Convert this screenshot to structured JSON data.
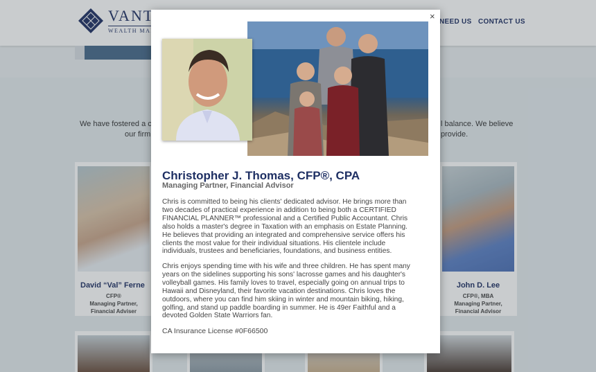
{
  "header": {
    "logo_name": "VANT",
    "logo_sub": "WEALTH MANAG",
    "nav": [
      "NEED US",
      "CONTACT US"
    ]
  },
  "intro": {
    "left_line1": "We have fostered a cu",
    "left_line2": "our firm",
    "right_line1": "l balance. We believe",
    "right_line2": "provide."
  },
  "cards": [
    {
      "name": "David “Val” Ferne",
      "title_lines": [
        "CFP®",
        "Managing Partner,",
        "Financial Adviser"
      ]
    },
    {
      "name": "John D. Lee",
      "title_lines": [
        "CFP®, MBA",
        "Managing Partner,",
        "Financial Advisor"
      ]
    }
  ],
  "modal": {
    "close_label": "×",
    "name": "Christopher J. Thomas, CFP®, CPA",
    "title": "Managing Partner, Financial Advisor",
    "paragraph1": [
      "Chris is committed to being his clients' dedicated advisor. He brings more than",
      "two decades of practical experience in addition to being both a CERTIFIED",
      "FINANCIAL PLANNER™ professional and a Certified Public Accountant. Chris",
      "also holds a master's degree in Taxation with an emphasis on Estate Planning.",
      "He believes that providing an integrated and comprehensive service offers his",
      "clients the most value for their individual situations. His clientele include",
      "individuals, trustees and beneficiaries, foundations, and business entities."
    ],
    "paragraph2": [
      "Chris enjoys spending time with his wife and three children. He has spent many",
      "years on the sidelines supporting his sons' lacrosse games and his daughter's",
      "volleyball games. His family loves to travel, especially going on annual trips to",
      "Hawaii and Disneyland, their favorite vacation destinations. Chris loves the",
      "outdoors, where you can find him skiing in winter and mountain biking, hiking,",
      "golfing, and stand up paddle boarding in summer. He is 49er Faithful and a",
      "devoted Golden State Warriors fan."
    ],
    "license": "CA Insurance License #0F66500"
  },
  "colors": {
    "brand_navy": "#1e2f63",
    "overlay": "rgba(60,72,80,0.28)"
  }
}
